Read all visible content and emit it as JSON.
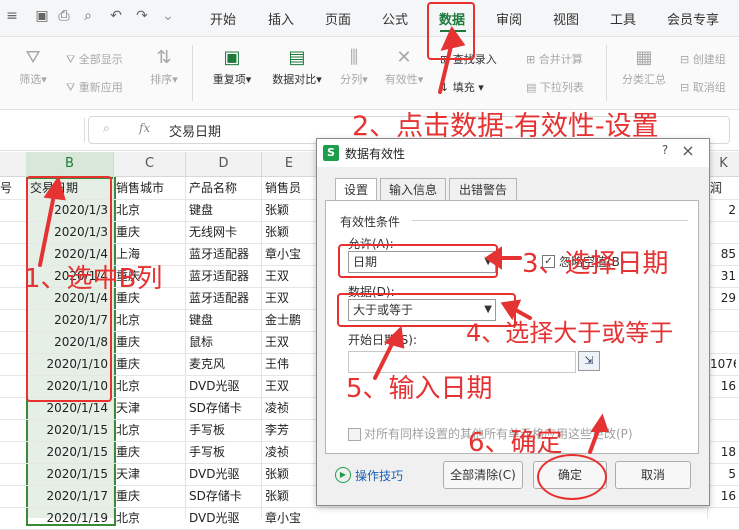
{
  "menubar": {
    "tabs": [
      "开始",
      "插入",
      "页面",
      "公式",
      "数据",
      "审阅",
      "视图",
      "工具",
      "会员专享"
    ],
    "active_tab": "数据"
  },
  "ribbon": {
    "filter": "筛选",
    "show_all": "全部显示",
    "reapply": "重新应用",
    "sort": "排序",
    "duplicates": "重复项",
    "compare": "数据对比",
    "split": "分列",
    "validity": "有效性",
    "lookup_entry": "查找录入",
    "fill": "填充",
    "merge_calc": "合并计算",
    "dropdown_list": "下拉列表",
    "subtotal": "分类汇总",
    "create_group": "创建组",
    "ungroup": "取消组"
  },
  "formula_bar": {
    "fx": "fx",
    "content": "交易日期"
  },
  "columns": {
    "headers": [
      "B",
      "C",
      "D",
      "E",
      "K"
    ]
  },
  "sheet": {
    "col_a_partial": "号",
    "header_row": [
      "交易日期",
      "销售城市",
      "产品名称",
      "销售员"
    ],
    "col_k_header_partial": "润",
    "rows": [
      {
        "date": "2020/1/3",
        "city": "北京",
        "product": "键盘",
        "seller": "张颖",
        "k": "2"
      },
      {
        "date": "2020/1/3",
        "city": "重庆",
        "product": "无线网卡",
        "seller": "张颖",
        "k": ""
      },
      {
        "date": "2020/1/4",
        "city": "上海",
        "product": "蓝牙适配器",
        "seller": "章小宝",
        "k": "85"
      },
      {
        "date": "2020/1/4",
        "city": "重庆",
        "product": "蓝牙适配器",
        "seller": "王双",
        "k": "31"
      },
      {
        "date": "2020/1/4",
        "city": "重庆",
        "product": "蓝牙适配器",
        "seller": "王双",
        "k": "29"
      },
      {
        "date": "2020/1/7",
        "city": "北京",
        "product": "键盘",
        "seller": "金士鹏",
        "k": ""
      },
      {
        "date": "2020/1/8",
        "city": "重庆",
        "product": "鼠标",
        "seller": "王双",
        "k": ""
      },
      {
        "date": "2020/1/10",
        "city": "重庆",
        "product": "麦克风",
        "seller": "王伟",
        "k": "1076"
      },
      {
        "date": "2020/1/10",
        "city": "北京",
        "product": "DVD光驱",
        "seller": "王双",
        "k": "16"
      },
      {
        "date": "2020/1/14",
        "city": "天津",
        "product": "SD存储卡",
        "seller": "凌祯",
        "k": ""
      },
      {
        "date": "2020/1/15",
        "city": "北京",
        "product": "手写板",
        "seller": "李芳",
        "k": ""
      },
      {
        "date": "2020/1/15",
        "city": "重庆",
        "product": "手写板",
        "seller": "凌祯",
        "k": "18"
      },
      {
        "date": "2020/1/15",
        "city": "天津",
        "product": "DVD光驱",
        "seller": "张颖",
        "k": "5"
      },
      {
        "date": "2020/1/17",
        "city": "重庆",
        "product": "SD存储卡",
        "seller": "张颖",
        "k": "16"
      },
      {
        "date": "2020/1/19",
        "city": "北京",
        "product": "DVD光驱",
        "seller": "章小宝",
        "k": ""
      }
    ]
  },
  "dialog": {
    "icon_letter": "S",
    "title": "数据有效性",
    "help": "?",
    "close": "×",
    "tabs": [
      "设置",
      "输入信息",
      "出错警告"
    ],
    "section_label": "有效性条件",
    "allow_label": "允许(A):",
    "allow_value": "日期",
    "ignore_blank_label": "忽略空值(B)",
    "data_label": "数据(D):",
    "data_value": "大于或等于",
    "start_date_label": "开始日期(S):",
    "apply_all_label": "对所有同样设置的其他所有单元格应用这些更改(P)",
    "tips_label": "操作技巧",
    "clear_all": "全部清除(C)",
    "ok": "确定",
    "cancel": "取消"
  },
  "annotations": {
    "step1": "1、选中B列",
    "step2": "2、点击数据-有效性-设置",
    "step3": "3、选择日期",
    "step4": "4、选择大于或等于",
    "step5": "5、输入日期",
    "step6": "6、确定"
  },
  "colors": {
    "accent": "#1d7a3a",
    "annotation_red": "#e53333",
    "selection_green": "#3a8a3a"
  }
}
